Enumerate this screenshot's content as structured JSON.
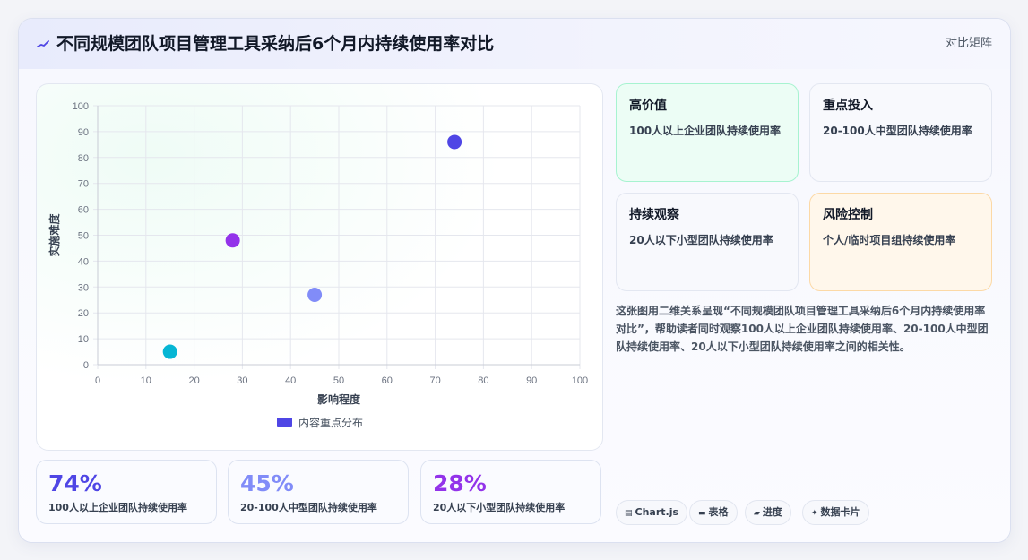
{
  "header": {
    "icon": "sparkline-icon",
    "title": "不同规模团队项目管理工具采纳后6个月内持续使用率对比",
    "tag": "对比矩阵"
  },
  "quadrants": [
    {
      "title": "高价值",
      "desc": "100人以上企业团队持续使用率",
      "accent": "#ecfdf5"
    },
    {
      "title": "重点投入",
      "desc": "20-100人中型团队持续使用率",
      "accent": "#f8f9fd"
    },
    {
      "title": "持续观察",
      "desc": "20人以下小型团队持续使用率",
      "accent": "#f8f9fd"
    },
    {
      "title": "风险控制",
      "desc": "个人/临时项目组持续使用率",
      "accent": "#fff7eb"
    }
  ],
  "description": "这张图用二维关系呈现“不同规模团队项目管理工具采纳后6个月内持续使用率对比”，帮助读者同时观察100人以上企业团队持续使用率、20-100人中型团队持续使用率、20人以下小型团队持续使用率之间的相关性。",
  "stats": [
    {
      "value": "74%",
      "label": "100人以上企业团队持续使用率",
      "color": "#4f46e5"
    },
    {
      "value": "45%",
      "label": "20-100人中型团队持续使用率",
      "color": "#818cf8"
    },
    {
      "value": "28%",
      "label": "20人以下小型团队持续使用率",
      "color": "#9333ea"
    }
  ],
  "pills": [
    {
      "icon": "chart-icon",
      "glyph": "▤",
      "label": "Chart.js"
    },
    {
      "icon": "table-icon",
      "glyph": "▬",
      "label": "表格"
    },
    {
      "icon": "progress-icon",
      "glyph": "▰",
      "label": "进度"
    },
    {
      "icon": "card-icon",
      "glyph": "✦",
      "label": "数据卡片"
    }
  ],
  "chart_data": {
    "type": "scatter",
    "xlabel": "影响程度",
    "ylabel": "实施难度",
    "xlim": [
      0,
      100
    ],
    "ylim": [
      0,
      100
    ],
    "xticks": [
      0,
      10,
      20,
      30,
      40,
      50,
      60,
      70,
      80,
      90,
      100
    ],
    "yticks": [
      0,
      10,
      20,
      30,
      40,
      50,
      60,
      70,
      80,
      90,
      100
    ],
    "grid": true,
    "legend": {
      "position": "bottom",
      "label": "内容重点分布",
      "color": "#4f46e5"
    },
    "series": [
      {
        "name": "内容重点分布",
        "points": [
          {
            "x": 74,
            "y": 86,
            "color": "#4f46e5"
          },
          {
            "x": 45,
            "y": 27,
            "color": "#818cf8"
          },
          {
            "x": 28,
            "y": 48,
            "color": "#9333ea"
          },
          {
            "x": 15,
            "y": 5,
            "color": "#06b6d4"
          }
        ]
      }
    ]
  }
}
